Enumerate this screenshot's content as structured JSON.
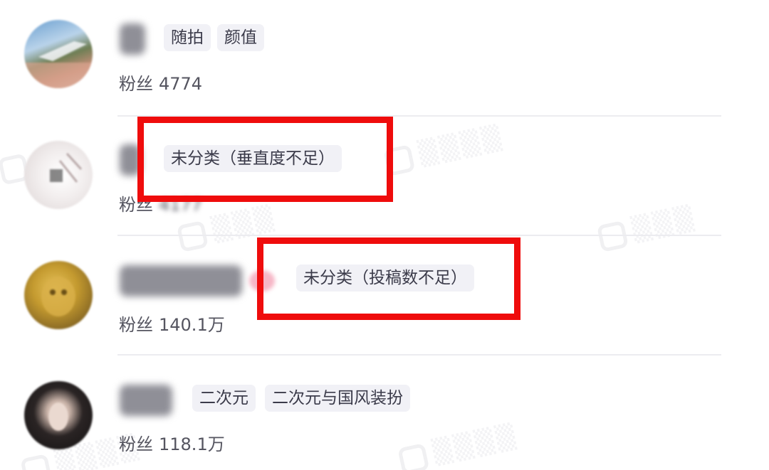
{
  "rows": [
    {
      "tags": [
        "随拍",
        "颜值"
      ],
      "fans_label": "粉丝",
      "fans_value": "4774"
    },
    {
      "tags": [
        "未分类（垂直度不足）"
      ],
      "fans_label": "粉丝",
      "fans_value": "4177"
    },
    {
      "tags": [
        "未分类（投稿数不足）"
      ],
      "fans_label": "粉丝",
      "fans_value": "140.1万"
    },
    {
      "tags": [
        "二次元",
        "二次元与国风装扮"
      ],
      "fans_label": "粉丝",
      "fans_value": "118.1万"
    }
  ],
  "colors": {
    "highlight": "#ef0c0c",
    "tag_background": "#f1f1f6",
    "divider": "#ececf0"
  }
}
